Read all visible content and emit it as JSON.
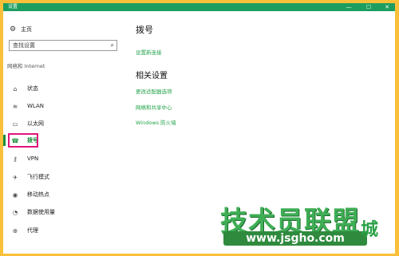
{
  "window": {
    "title": "设置",
    "minimize_glyph": "—",
    "maximize_glyph": "☐",
    "close_glyph": "✕"
  },
  "sidebar": {
    "home_label": "主页",
    "search_placeholder": "查找设置",
    "section_label": "网络和 Internet",
    "items": [
      {
        "label": "状态",
        "icon": "⌂"
      },
      {
        "label": "WLAN",
        "icon": "≋"
      },
      {
        "label": "以太网",
        "icon": "▭"
      },
      {
        "label": "拨号",
        "icon": "☎"
      },
      {
        "label": "VPN",
        "icon": "⚷"
      },
      {
        "label": "飞行模式",
        "icon": "✈"
      },
      {
        "label": "移动热点",
        "icon": "◉"
      },
      {
        "label": "数据使用量",
        "icon": "◔"
      },
      {
        "label": "代理",
        "icon": "⊕"
      }
    ],
    "selected_index": 3
  },
  "main": {
    "title": "拨号",
    "setup_link": "设置新连接",
    "related_title": "相关设置",
    "related_links": [
      "更改适配器选项",
      "网络和共享中心",
      "Windows 防火墙"
    ]
  },
  "watermark": {
    "text": "技术员联盟",
    "url": "www.jsgho.com",
    "side_text": "城"
  },
  "colors": {
    "titlebar": "#1d9e60",
    "accent": "#1a8f3c",
    "link": "#23a34a",
    "highlight": "#e0137a",
    "frame": "#fbc03a"
  }
}
